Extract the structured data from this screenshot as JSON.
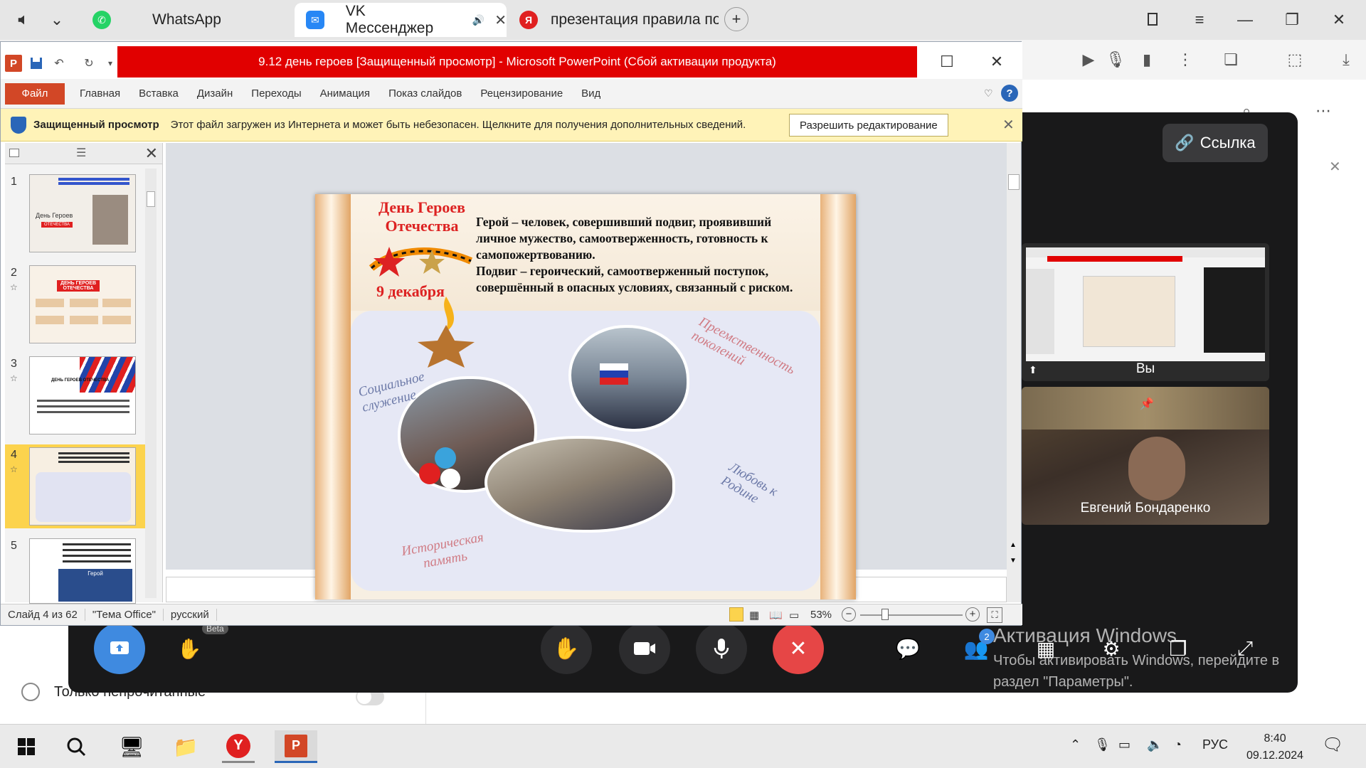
{
  "browser": {
    "tabs": [
      {
        "label": "WhatsApp"
      },
      {
        "label": "VK Мессенджер"
      },
      {
        "label": "презентация правила по"
      }
    ]
  },
  "powerpoint": {
    "title": "9.12 день героев [Защищенный просмотр] - Microsoft PowerPoint (Сбой активации продукта)",
    "ribbon_tabs": [
      "Файл",
      "Главная",
      "Вставка",
      "Дизайн",
      "Переходы",
      "Анимация",
      "Показ слайдов",
      "Рецензирование",
      "Вид"
    ],
    "protected_view": {
      "title": "Защищенный просмотр",
      "message": "Этот файл загружен из Интернета и может быть небезопасен. Щелкните для получения дополнительных сведений.",
      "button": "Разрешить редактирование"
    },
    "thumbnails": [
      {
        "num": "1",
        "caption": "День Героев",
        "badge": "ОТЕЧЕСТВА"
      },
      {
        "num": "2",
        "caption": "ДЕНЬ ГЕРОЕВ ОТЕЧЕСТВА"
      },
      {
        "num": "3",
        "caption": "ДЕНЬ ГЕРОЕВ ОТЕЧЕСТВА"
      },
      {
        "num": "4",
        "caption": ""
      },
      {
        "num": "5",
        "caption": "Герой"
      }
    ],
    "selected_slide": 4,
    "slide": {
      "logo_line1": "День Героев",
      "logo_line2": "Отечества",
      "logo_date": "9 декабря",
      "text_lines": [
        "Герой – человек, совершивший подвиг, проявивший",
        "личное мужество, самоотверженность, готовность к",
        "самопожертвованию.",
        "Подвиг – героический, самоотверженный поступок,",
        "совершённый в опасных условиях, связанный с риском."
      ],
      "labels": {
        "social": "Социальное служение",
        "succession": "Преемственность поколений",
        "love": "Любовь к Родине",
        "memory": "Историческая память"
      }
    },
    "status": {
      "slide": "Слайд 4 из 62",
      "theme": "\"Тема Office\"",
      "lang": "русский",
      "zoom": "53%"
    }
  },
  "call": {
    "link_label": "Ссылка",
    "self_label": "Вы",
    "participant_name": "Евгений Бондаренко",
    "beta_label": "Beta",
    "participants_count": "2"
  },
  "vk": {
    "unread_label": "Только непрочитанные"
  },
  "windows_activation": {
    "title": "Активация Windows",
    "subtitle": "Чтобы активировать Windows, перейдите в раздел \"Параметры\"."
  },
  "taskbar": {
    "lang": "РУС",
    "time": "8:40",
    "date": "09.12.2024"
  },
  "colors": {
    "ppt_accent": "#d24726",
    "title_bar_red": "#e10000",
    "end_call": "#e64646",
    "vk_blue": "#3f8ae0"
  }
}
